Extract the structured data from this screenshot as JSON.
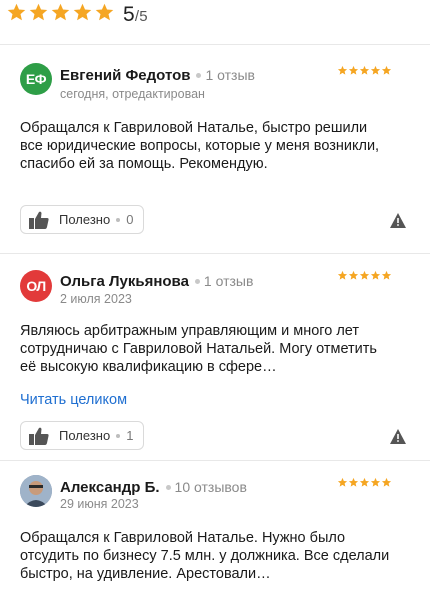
{
  "summary": {
    "rating": "5",
    "rating_max": "/5",
    "stars_filled": 5
  },
  "colors": {
    "star": "#f5a623",
    "link": "#1f6fd1"
  },
  "reviews": [
    {
      "avatar_initials": "ЕФ",
      "avatar_color": "#2e9e47",
      "author": "Евгений Федотов",
      "reviews_count": "1 отзыв",
      "date": "сегодня, отредактирован",
      "stars": 5,
      "text": "Обращался к Гавриловой Наталье, быстро решили все юридические вопросы, которые у меня возникли, спасибо ей за помощь. Рекомендую.",
      "read_more": "",
      "helpful_label": "Полезно",
      "helpful_count": "0"
    },
    {
      "avatar_initials": "ОЛ",
      "avatar_color": "#e23a3a",
      "author": "Ольга Лукьянова",
      "reviews_count": "1 отзыв",
      "date": "2 июля 2023",
      "stars": 5,
      "text": "Являюсь арбитражным управляющим и много лет сотрудничаю с Гавриловой Натальей. Могу отметить её высокую квалификацию в сфере…",
      "read_more": "Читать целиком",
      "helpful_label": "Полезно",
      "helpful_count": "1"
    },
    {
      "avatar_initials": "",
      "avatar_color": "#7a8ea8",
      "author": "Александр Б.",
      "reviews_count": "10 отзывов",
      "date": "29 июня 2023",
      "stars": 5,
      "text": "Обращался к Гавриловой Наталье. Нужно было отсудить по бизнесу 7.5 млн. у должника. Все сделали быстро, на удивление. Арестовали…",
      "read_more": "",
      "helpful_label": "",
      "helpful_count": ""
    }
  ]
}
